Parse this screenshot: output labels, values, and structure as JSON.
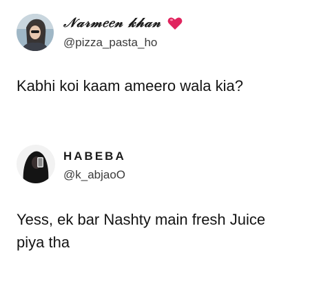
{
  "tweets": [
    {
      "display_name": "𝒩𝒶𝓇𝓂𝑒𝑒𝓃 𝓀𝒽𝒶𝓃",
      "name_emoji_icon": "red-heart-icon",
      "handle": "@pizza_pasta_ho",
      "text": "Kabhi koi kaam ameero wala kia?"
    },
    {
      "display_name": "HABEBA",
      "handle": "@k_abjaoO",
      "text": "Yess, ek bar Nashty main fresh Juice piya tha"
    }
  ],
  "colors": {
    "heart": "#e0245e",
    "text": "#14171a",
    "handle": "#3a3a3a"
  }
}
